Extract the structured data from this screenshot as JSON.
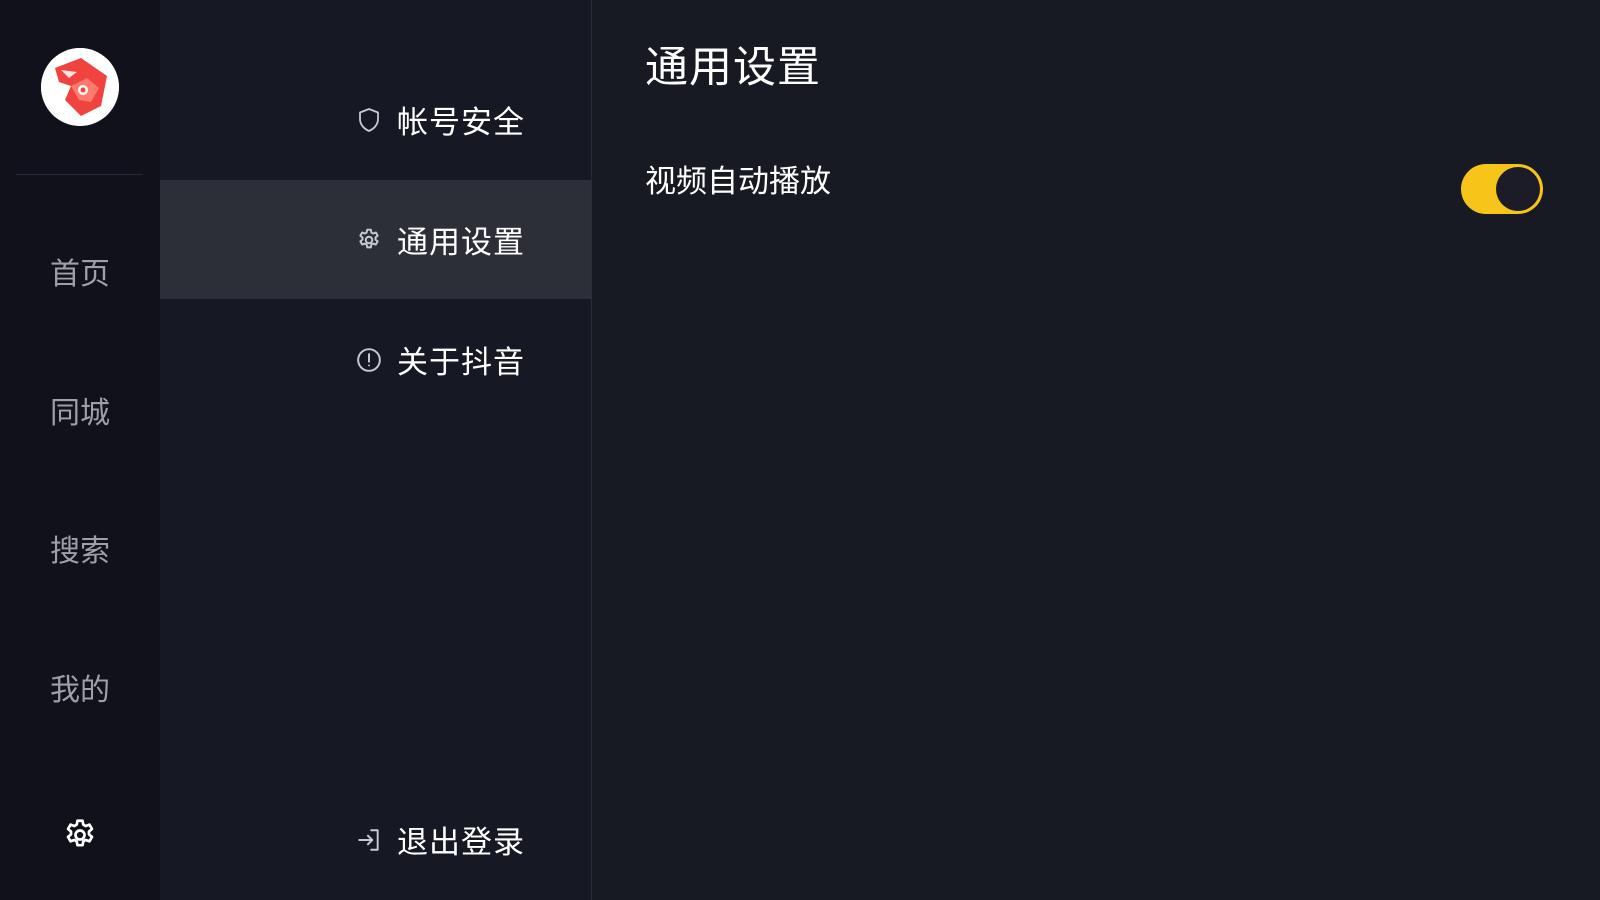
{
  "rail": {
    "avatar_icon": "fox-logo-icon",
    "nav": [
      {
        "label": "首页"
      },
      {
        "label": "同城"
      },
      {
        "label": "搜索"
      },
      {
        "label": "我的"
      }
    ],
    "settings_icon": "gear-icon"
  },
  "menu": {
    "items": [
      {
        "label": "帐号安全",
        "icon": "shield-icon"
      },
      {
        "label": "通用设置",
        "icon": "gear-icon",
        "active": true
      },
      {
        "label": "关于抖音",
        "icon": "info-circle-icon"
      }
    ],
    "logout": {
      "label": "退出登录",
      "icon": "logout-icon"
    }
  },
  "content": {
    "title": "通用设置",
    "settings": [
      {
        "label": "视频自动播放",
        "enabled": true
      }
    ]
  },
  "colors": {
    "accent": "#f7c519",
    "background": "#171923",
    "rail_background": "#10111a",
    "active_item": "#2c2e38",
    "muted_text": "#9ea0a9"
  }
}
